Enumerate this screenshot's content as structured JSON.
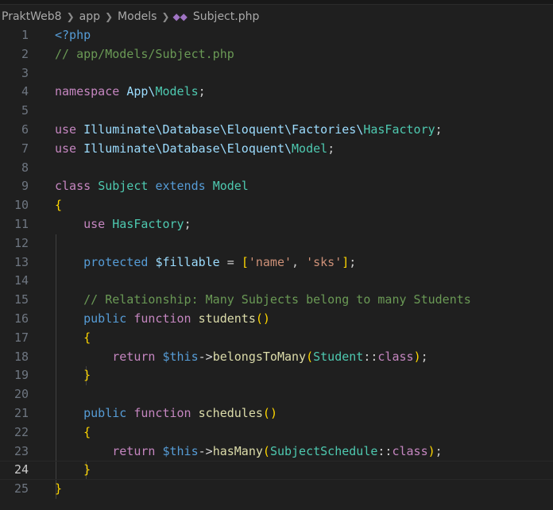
{
  "breadcrumb": {
    "segments": [
      "PraktWeb8",
      "app",
      "Models",
      "Subject.php"
    ],
    "file_icon": "php-elephant-icon"
  },
  "editor": {
    "active_line": 24,
    "line_numbers": [
      "1",
      "2",
      "3",
      "4",
      "5",
      "6",
      "7",
      "8",
      "9",
      "10",
      "11",
      "12",
      "13",
      "14",
      "15",
      "16",
      "17",
      "18",
      "19",
      "20",
      "21",
      "22",
      "23",
      "24",
      "25"
    ],
    "lines": [
      "<?php",
      "// app/Models/Subject.php",
      "",
      "namespace App\\Models;",
      "",
      "use Illuminate\\Database\\Eloquent\\Factories\\HasFactory;",
      "use Illuminate\\Database\\Eloquent\\Model;",
      "",
      "class Subject extends Model",
      "{",
      "    use HasFactory;",
      "",
      "    protected $fillable = ['name', 'sks'];",
      "",
      "    // Relationship: Many Subjects belong to many Students",
      "    public function students()",
      "    {",
      "        return $this->belongsToMany(Student::class);",
      "    }",
      "",
      "    public function schedules()",
      "    {",
      "        return $this->hasMany(SubjectSchedule::class);",
      "    }",
      "}"
    ]
  },
  "colors": {
    "background": "#1f1f1f",
    "keyword": "#c586c0",
    "namespace": "#9cdcfe",
    "class": "#4ec9b0",
    "function": "#dcdcaa",
    "string": "#ce9178",
    "comment": "#6a9955",
    "line_number": "#6e7681"
  }
}
